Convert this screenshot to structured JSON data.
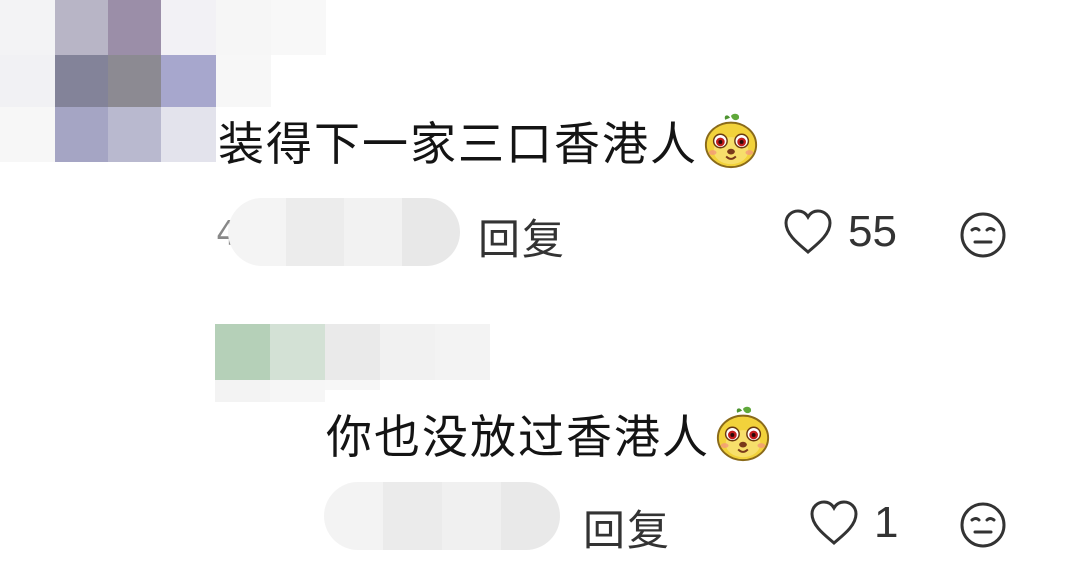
{
  "comments": [
    {
      "text": "装得下一家三口香港人",
      "emoji": "mascot-emoji",
      "meta_cut": "4",
      "reply_label": "回复",
      "likes": "55",
      "reaction_icon": "neutral-face-icon"
    },
    {
      "text": "你也没放过香港人",
      "emoji": "mascot-emoji",
      "reply_label": "回复",
      "likes": "1",
      "reaction_icon": "neutral-face-icon"
    }
  ],
  "colors": {
    "text": "#141414",
    "meta": "#333333",
    "background": "#ffffff"
  }
}
